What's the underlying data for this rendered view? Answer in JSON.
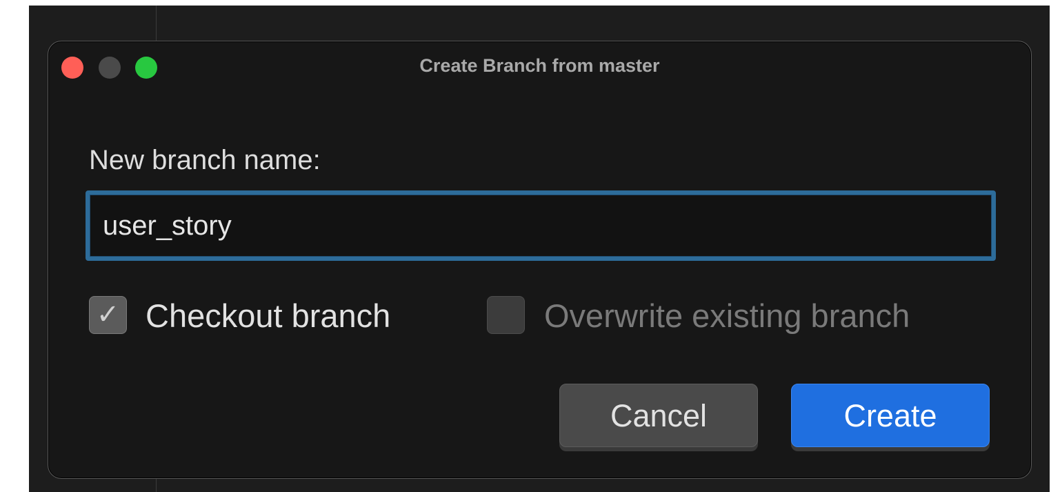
{
  "dialog": {
    "title": "Create Branch from master",
    "field_label": "New branch name:",
    "branch_name_value": "user_story",
    "checkout": {
      "label": "Checkout branch",
      "checked": true,
      "check_glyph": "✓"
    },
    "overwrite": {
      "label": "Overwrite existing branch",
      "checked": false
    },
    "cancel_label": "Cancel",
    "create_label": "Create"
  },
  "icons": {
    "close": "close-window-icon",
    "minimize": "minimize-window-icon",
    "maximize": "maximize-window-icon",
    "check": "checkmark-icon"
  },
  "colors": {
    "close": "#ff5f57",
    "minimize": "#4a4a4a",
    "maximize": "#28c840",
    "accent": "#1f6fe0",
    "focus_ring": "#2d6c9a"
  }
}
